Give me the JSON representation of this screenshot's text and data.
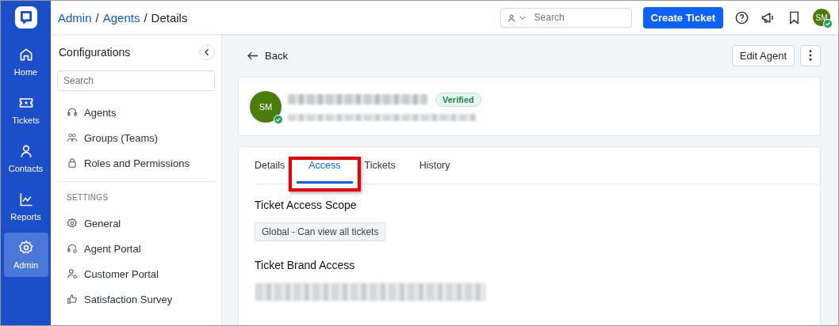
{
  "rail": {
    "items": [
      {
        "label": "Home",
        "kind": "home",
        "selected": false
      },
      {
        "label": "Tickets",
        "kind": "ticket",
        "selected": false
      },
      {
        "label": "Contacts",
        "kind": "person",
        "selected": false
      },
      {
        "label": "Reports",
        "kind": "chart",
        "selected": false
      },
      {
        "label": "Admin",
        "kind": "gear",
        "selected": true
      }
    ]
  },
  "breadcrumb": [
    {
      "label": "Admin",
      "kind": "link"
    },
    {
      "label": "/",
      "kind": "separator"
    },
    {
      "label": "Agents",
      "kind": "link"
    },
    {
      "label": "/",
      "kind": "separator"
    },
    {
      "label": "Details",
      "kind": "current"
    }
  ],
  "topbar": {
    "search": {
      "placeholder": "Search"
    },
    "create_button": "Create Ticket",
    "avatar": {
      "initials": "SM",
      "online": true
    }
  },
  "config": {
    "title": "Configurations",
    "search": {
      "placeholder": "Search"
    },
    "items": [
      {
        "label": "Agents",
        "kind": "headset"
      },
      {
        "label": "Groups (Teams)",
        "kind": "group"
      },
      {
        "label": "Roles and Permissions",
        "kind": "lock"
      }
    ],
    "settings_heading": "SETTINGS",
    "settings": [
      {
        "label": "General",
        "kind": "gear"
      },
      {
        "label": "Agent Portal",
        "kind": "headset-gear"
      },
      {
        "label": "Customer Portal",
        "kind": "person-gear"
      },
      {
        "label": "Satisfaction Survey",
        "kind": "thumb"
      }
    ]
  },
  "back": "Back",
  "edit_button": "Edit Agent",
  "profile": {
    "initials": "SM",
    "online": true,
    "badge": "Verified"
  },
  "tabs": [
    {
      "label": "Details",
      "selected": false,
      "annotated": false
    },
    {
      "label": "Access",
      "selected": true,
      "annotated": true
    },
    {
      "label": "Tickets",
      "selected": false,
      "annotated": false
    },
    {
      "label": "History",
      "selected": false,
      "annotated": false
    }
  ],
  "access": {
    "scope_heading": "Ticket Access Scope",
    "scope_value": "Global - Can view all tickets",
    "brand_heading": "Ticket Brand Access"
  }
}
